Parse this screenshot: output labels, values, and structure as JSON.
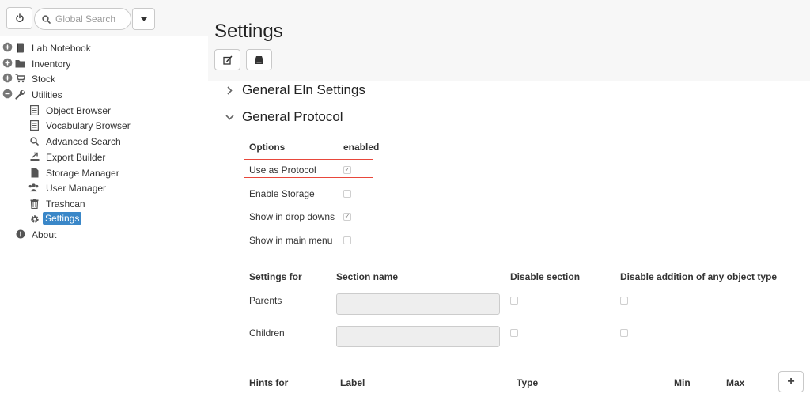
{
  "search": {
    "placeholder": "Global Search"
  },
  "sidebar": {
    "items": [
      {
        "label": "Lab Notebook",
        "icon": "notebook-icon",
        "expander": "plus-circle-icon"
      },
      {
        "label": "Inventory",
        "icon": "folder-icon",
        "expander": "plus-circle-icon"
      },
      {
        "label": "Stock",
        "icon": "cart-icon",
        "expander": "plus-circle-icon"
      },
      {
        "label": "Utilities",
        "icon": "wrench-icon",
        "expander": "minus-circle-icon"
      },
      {
        "label": "Object Browser",
        "icon": "list-icon"
      },
      {
        "label": "Vocabulary Browser",
        "icon": "list-icon"
      },
      {
        "label": "Advanced Search",
        "icon": "search-icon"
      },
      {
        "label": "Export Builder",
        "icon": "export-icon"
      },
      {
        "label": "Storage Manager",
        "icon": "file-icon"
      },
      {
        "label": "User Manager",
        "icon": "users-icon"
      },
      {
        "label": "Trashcan",
        "icon": "trash-icon"
      },
      {
        "label": "Settings",
        "icon": "gear-icon",
        "selected": true
      },
      {
        "label": "About",
        "icon": "info-icon"
      }
    ]
  },
  "main": {
    "title": "Settings",
    "sections": [
      {
        "label": "General Eln Settings",
        "expanded": false
      },
      {
        "label": "General Protocol",
        "expanded": true
      }
    ],
    "options": {
      "header_options": "Options",
      "header_enabled": "enabled",
      "rows": [
        {
          "label": "Use as Protocol",
          "checked": true,
          "highlighted": true
        },
        {
          "label": "Enable Storage",
          "checked": false
        },
        {
          "label": "Show in drop downs",
          "checked": true
        },
        {
          "label": "Show in main menu",
          "checked": false
        }
      ]
    },
    "sections_table": {
      "headers": [
        "Settings for",
        "Section name",
        "Disable section",
        "Disable addition of any object type"
      ],
      "rows": [
        {
          "label": "Parents",
          "section_name": "",
          "disable_section": false,
          "disable_addition": false
        },
        {
          "label": "Children",
          "section_name": "",
          "disable_section": false,
          "disable_addition": false
        }
      ]
    },
    "hints_table": {
      "headers": [
        "Hints for",
        "Label",
        "Type",
        "Min",
        "Max"
      ]
    },
    "add_button_label": "+"
  },
  "colors": {
    "accent": "#3a87c8",
    "highlight_border": "#e8473b",
    "header_bg": "#f7f7f7"
  }
}
